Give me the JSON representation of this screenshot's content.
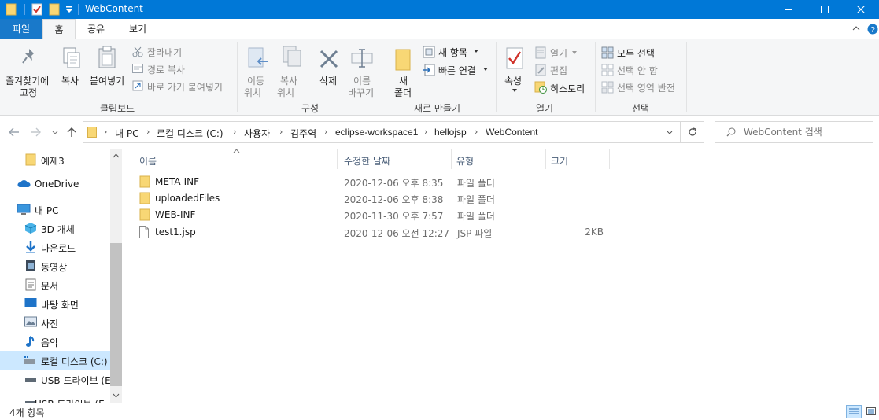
{
  "window": {
    "title": "WebContent",
    "controls": [
      "minimize-icon",
      "maximize-icon",
      "close-icon"
    ]
  },
  "quick_access": [
    "folder-icon",
    "properties-icon",
    "new-folder-icon",
    "dropdown-icon"
  ],
  "ribbon_tabs": [
    "파일",
    "홈",
    "공유",
    "보기"
  ],
  "ribbon": {
    "clipboard": {
      "pin_line1": "즐겨찾기에",
      "pin_line2": "고정",
      "copy": "복사",
      "paste": "붙여넣기",
      "cut": "잘라내기",
      "copy_path": "경로 복사",
      "paste_shortcut": "바로 가기 붙여넣기",
      "group": "클립보드"
    },
    "organize": {
      "move_line1": "이동",
      "move_line2": "위치",
      "copy_line1": "복사",
      "copy_line2": "위치",
      "delete": "삭제",
      "rename_line1": "이름",
      "rename_line2": "바꾸기",
      "group": "구성"
    },
    "new": {
      "folder_line1": "새",
      "folder_line2": "폴더",
      "new_item": "새 항목",
      "easy_access": "빠른 연결",
      "group": "새로 만들기"
    },
    "open": {
      "properties": "속성",
      "open": "열기",
      "edit": "편집",
      "history": "히스토리",
      "group": "열기"
    },
    "select": {
      "select_all": "모두 선택",
      "select_none": "선택 안 함",
      "invert": "선택 영역 반전",
      "group": "선택"
    }
  },
  "breadcrumb": [
    "내 PC",
    "로컬 디스크 (C:)",
    "사용자",
    "김주역",
    "eclipse-workspace1",
    "hellojsp",
    "WebContent"
  ],
  "search": {
    "placeholder": "WebContent 검색"
  },
  "nav_items": [
    {
      "label": "예제3",
      "icon": "folder-icon"
    },
    {
      "label": "OneDrive",
      "icon": "cloud-icon"
    },
    {
      "label": "내 PC",
      "icon": "computer-icon"
    },
    {
      "label": "3D 개체",
      "icon": "cube-icon"
    },
    {
      "label": "다운로드",
      "icon": "download-icon"
    },
    {
      "label": "동영상",
      "icon": "video-icon"
    },
    {
      "label": "문서",
      "icon": "document-icon"
    },
    {
      "label": "바탕 화면",
      "icon": "desktop-icon"
    },
    {
      "label": "사진",
      "icon": "picture-icon"
    },
    {
      "label": "음악",
      "icon": "music-icon"
    },
    {
      "label": "로컬 디스크 (C:)",
      "icon": "drive-icon"
    },
    {
      "label": "USB 드라이브 (E",
      "icon": "usb-icon"
    },
    {
      "label": "USB 드라이브 (E",
      "icon": "usb-icon"
    }
  ],
  "columns": {
    "name": "이름",
    "date": "수정한 날짜",
    "type": "유형",
    "size": "크기"
  },
  "files": [
    {
      "name": "META-INF",
      "date": "2020-12-06 오후 8:35",
      "type": "파일 폴더",
      "size": "",
      "icon": "folder-icon"
    },
    {
      "name": "uploadedFiles",
      "date": "2020-12-06 오후 8:38",
      "type": "파일 폴더",
      "size": "",
      "icon": "folder-icon"
    },
    {
      "name": "WEB-INF",
      "date": "2020-11-30 오후 7:57",
      "type": "파일 폴더",
      "size": "",
      "icon": "folder-icon"
    },
    {
      "name": "test1.jsp",
      "date": "2020-12-06 오전 12:27",
      "type": "JSP 파일",
      "size": "2KB",
      "icon": "file-icon"
    }
  ],
  "status": {
    "count": "4개 항목"
  },
  "colors": {
    "titlebar": "#0078d7",
    "file_tab": "#1979ca",
    "folder": "#f8d775",
    "selected_nav": "#cce8ff"
  }
}
